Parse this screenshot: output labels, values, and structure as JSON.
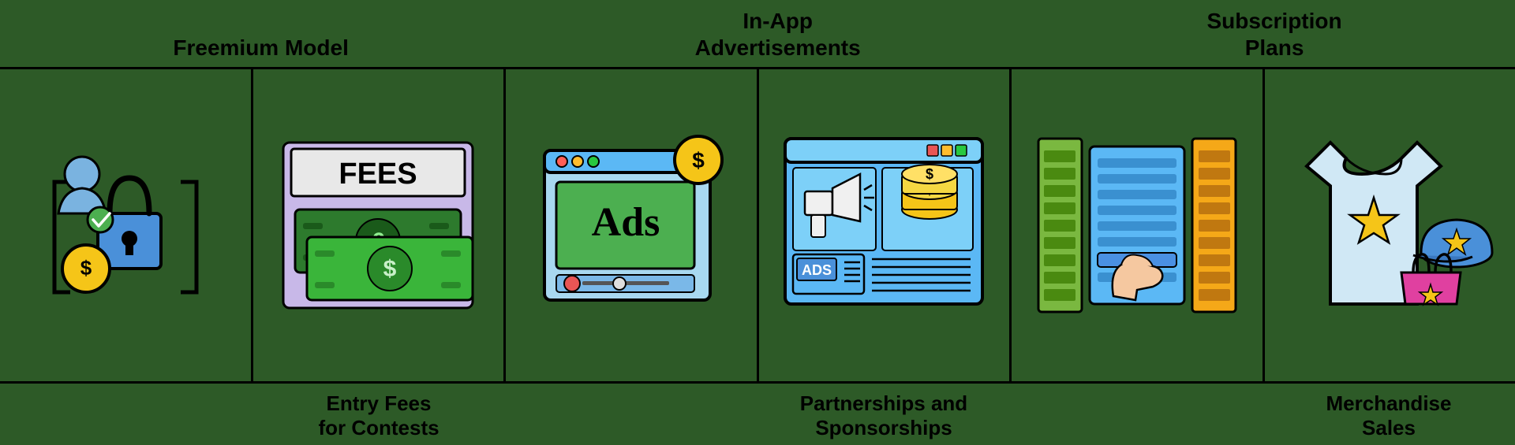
{
  "top_labels": [
    {
      "id": "freemium-model-label",
      "text": "Freemium Model"
    },
    {
      "id": "in-app-ads-label",
      "text": "In-App\nAdvertisements"
    },
    {
      "id": "subscription-plans-label",
      "text": "Subscription\nPlans"
    }
  ],
  "bottom_labels": [
    {
      "id": "freemium-bottom",
      "text": ""
    },
    {
      "id": "entry-fees-label",
      "text": "Entry Fees\nfor Contests"
    },
    {
      "id": "ads-bottom",
      "text": ""
    },
    {
      "id": "partnerships-label",
      "text": "Partnerships and\nSponsorships"
    },
    {
      "id": "subscription-bottom",
      "text": ""
    },
    {
      "id": "merchandise-label",
      "text": "Merchandise\nSales"
    }
  ],
  "cards": [
    {
      "id": "freemium-card"
    },
    {
      "id": "entry-fees-card"
    },
    {
      "id": "in-app-ads-card"
    },
    {
      "id": "partnerships-card"
    },
    {
      "id": "subscription-card"
    },
    {
      "id": "merchandise-card"
    }
  ],
  "colors": {
    "background": "#2d5a27",
    "border": "#000000",
    "text": "#000000"
  }
}
